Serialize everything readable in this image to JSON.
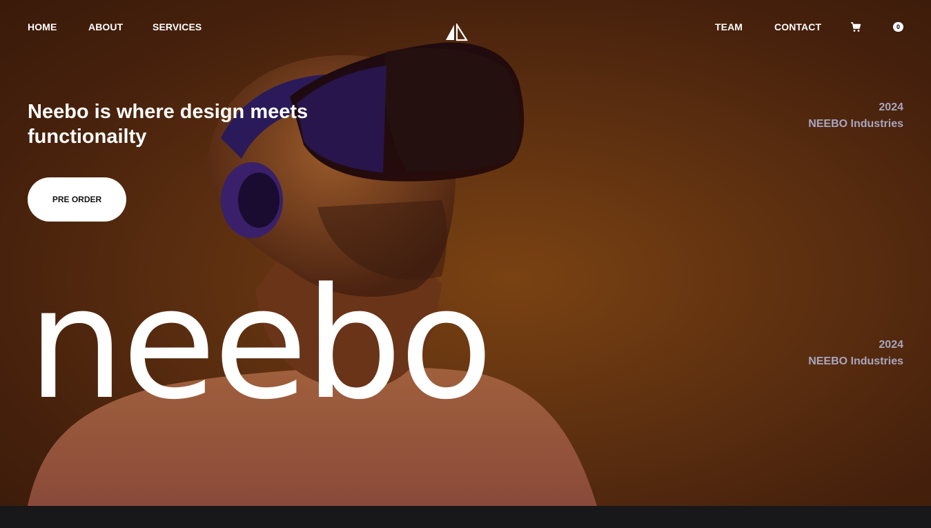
{
  "nav": {
    "home": "HOME",
    "about": "ABOUT",
    "services": "SERVICES",
    "team": "TEAM",
    "contact": "CONTACT",
    "cart_count": "0",
    "cart_icon": "cart-icon",
    "logo_icon": "sail-logo-icon"
  },
  "hero": {
    "headline": "Neebo is where design meets functionailty",
    "cta_label": "PRE ORDER",
    "brand_word": "neebo",
    "meta_top": {
      "year": "2024",
      "company": "NEEBO Industries"
    },
    "meta_bottom": {
      "year": "2024",
      "company": "NEEBO Industries"
    }
  },
  "colors": {
    "background": "#5e3010",
    "accent_text": "#a9a6c0",
    "footer": "#18181a"
  }
}
